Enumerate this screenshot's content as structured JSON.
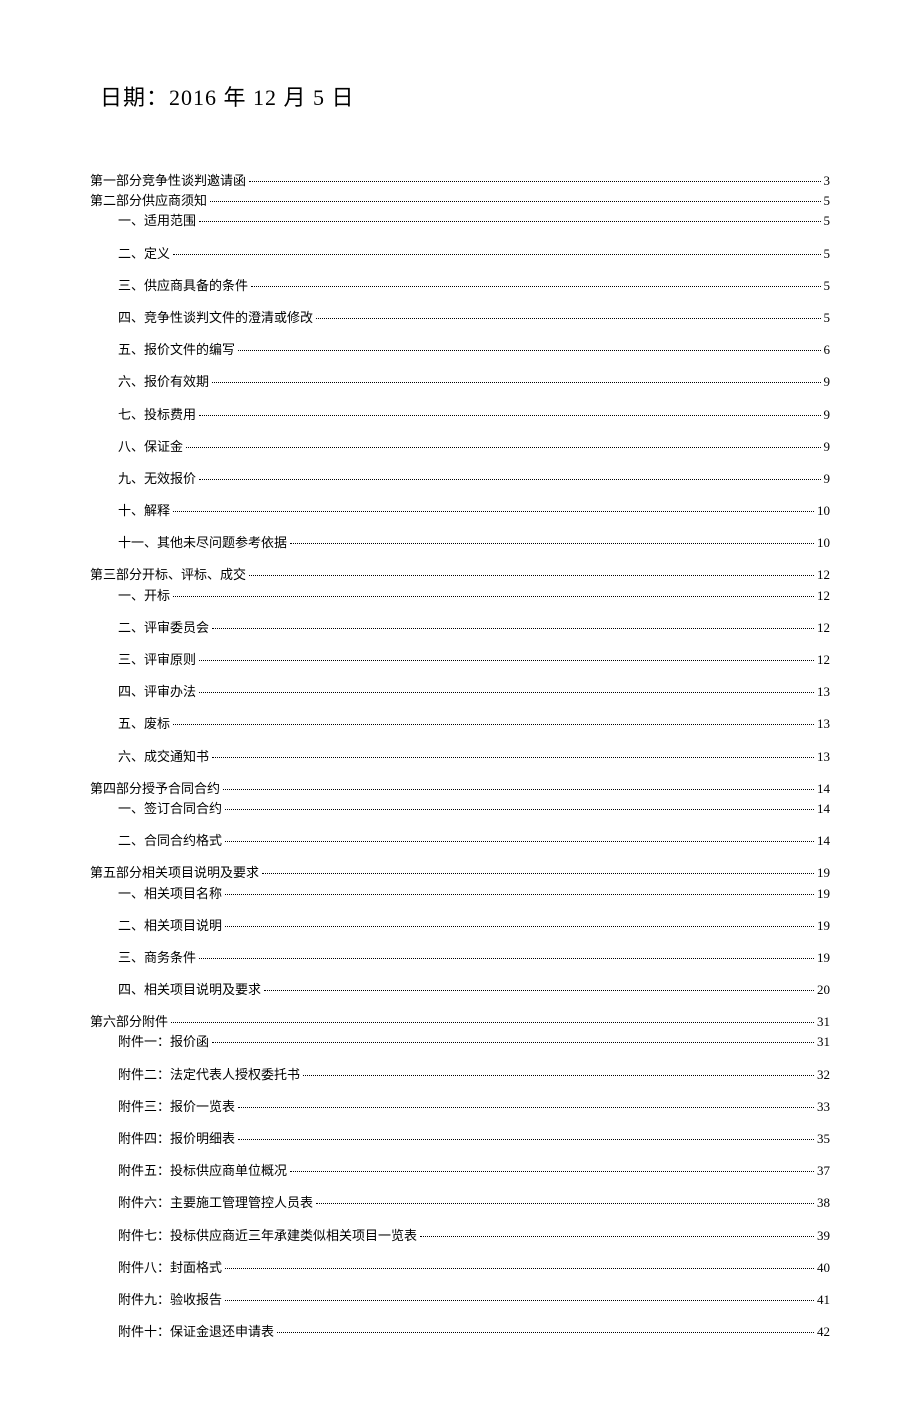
{
  "title": "日期：2016 年 12 月 5 日",
  "toc": [
    {
      "level": 1,
      "label": "第一部分竞争性谈判邀请函",
      "page": "3"
    },
    {
      "level": 1,
      "label": "第二部分供应商须知",
      "page": "5"
    },
    {
      "level": 2,
      "label": "一、适用范围",
      "page": "5"
    },
    {
      "level": 2,
      "label": "二、定义",
      "page": "5"
    },
    {
      "level": 2,
      "label": "三、供应商具备的条件",
      "page": "5"
    },
    {
      "level": 2,
      "label": "四、竞争性谈判文件的澄清或修改",
      "page": "5"
    },
    {
      "level": 2,
      "label": "五、报价文件的编写",
      "page": "6"
    },
    {
      "level": 2,
      "label": "六、报价有效期",
      "page": "9"
    },
    {
      "level": 2,
      "label": "七、投标费用",
      "page": "9"
    },
    {
      "level": 2,
      "label": "八、保证金",
      "page": "9"
    },
    {
      "level": 2,
      "label": "九、无效报价",
      "page": "9"
    },
    {
      "level": 2,
      "label": "十、解释",
      "page": "10"
    },
    {
      "level": 2,
      "label": "十一、其他未尽问题参考依据",
      "page": "10"
    },
    {
      "level": 1,
      "label": "第三部分开标、评标、成交",
      "page": "12"
    },
    {
      "level": 2,
      "label": "一、开标",
      "page": "12"
    },
    {
      "level": 2,
      "label": "二、评审委员会",
      "page": "12"
    },
    {
      "level": 2,
      "label": "三、评审原则",
      "page": "12"
    },
    {
      "level": 2,
      "label": "四、评审办法",
      "page": "13"
    },
    {
      "level": 2,
      "label": "五、废标",
      "page": "13"
    },
    {
      "level": 2,
      "label": "六、成交通知书",
      "page": "13"
    },
    {
      "level": 1,
      "label": "第四部分授予合同合约",
      "page": "14"
    },
    {
      "level": 2,
      "label": "一、签订合同合约",
      "page": "14"
    },
    {
      "level": 2,
      "label": "二、合同合约格式",
      "page": "14"
    },
    {
      "level": 1,
      "label": "第五部分相关项目说明及要求",
      "page": "19"
    },
    {
      "level": 2,
      "label": "一、相关项目名称",
      "page": "19"
    },
    {
      "level": 2,
      "label": "二、相关项目说明",
      "page": "19"
    },
    {
      "level": 2,
      "label": "三、商务条件",
      "page": "19"
    },
    {
      "level": 2,
      "label": "四、相关项目说明及要求",
      "page": "20"
    },
    {
      "level": 1,
      "label": "第六部分附件",
      "page": "31"
    },
    {
      "level": 2,
      "label": "附件一：报价函",
      "page": "31"
    },
    {
      "level": 2,
      "label": "附件二：法定代表人授权委托书",
      "page": "32"
    },
    {
      "level": 2,
      "label": "附件三：报价一览表",
      "page": "33"
    },
    {
      "level": 2,
      "label": "附件四：报价明细表",
      "page": "35"
    },
    {
      "level": 2,
      "label": "附件五：投标供应商单位概况",
      "page": "37"
    },
    {
      "level": 2,
      "label": "附件六：主要施工管理管控人员表",
      "page": "38"
    },
    {
      "level": 2,
      "label": "附件七：投标供应商近三年承建类似相关项目一览表",
      "page": "39"
    },
    {
      "level": 2,
      "label": "附件八：封面格式",
      "page": "40"
    },
    {
      "level": 2,
      "label": "附件九：验收报告",
      "page": "41"
    },
    {
      "level": 2,
      "label": "附件十：保证金退还申请表",
      "page": "42"
    }
  ]
}
